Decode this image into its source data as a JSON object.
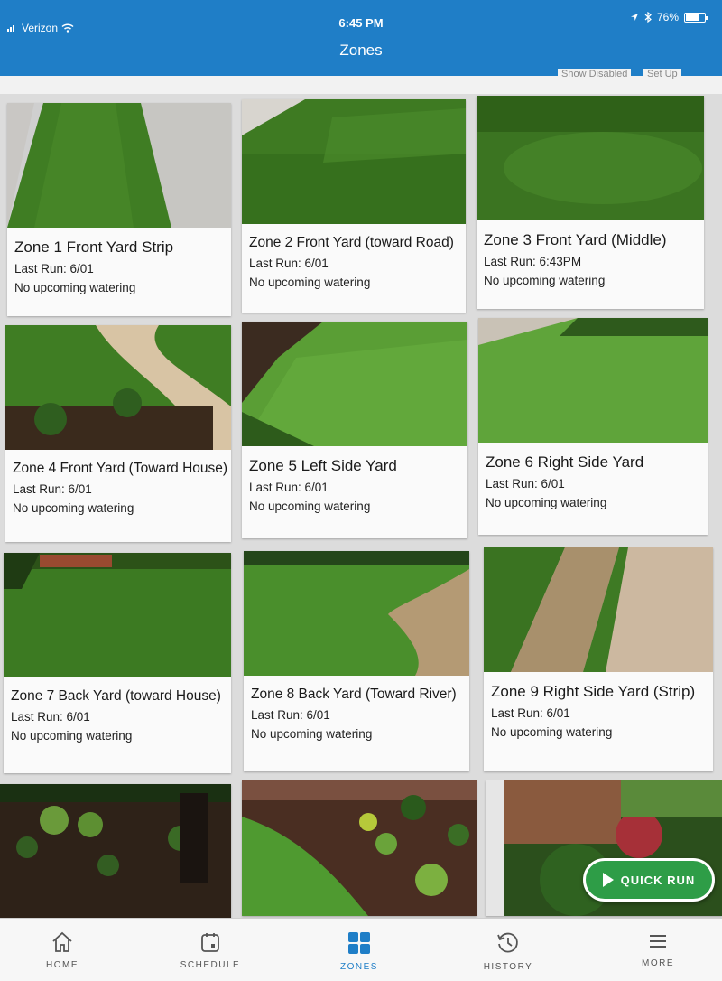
{
  "status_bar": {
    "carrier": "Verizon",
    "time": "6:45 PM",
    "battery": "76%",
    "battery_level": 0.76
  },
  "nav": {
    "title": "Zones"
  },
  "actions": {
    "show_disabled": "Show Disabled",
    "set_up": "Set Up"
  },
  "zones": [
    {
      "name": "Zone 1 Front Yard Strip",
      "last_run": "Last Run: 6/01",
      "upcoming": "No upcoming watering"
    },
    {
      "name": "Zone 2 Front Yard (toward Road)",
      "last_run": "Last Run: 6/01",
      "upcoming": "No upcoming watering"
    },
    {
      "name": "Zone 3 Front Yard (Middle)",
      "last_run": "Last Run: 6:43PM",
      "upcoming": "No upcoming watering"
    },
    {
      "name": "Zone 4 Front Yard (Toward House)",
      "last_run": "Last Run: 6/01",
      "upcoming": "No upcoming watering"
    },
    {
      "name": "Zone 5 Left Side Yard",
      "last_run": "Last Run: 6/01",
      "upcoming": "No upcoming watering"
    },
    {
      "name": "Zone 6 Right Side Yard",
      "last_run": "Last Run: 6/01",
      "upcoming": "No upcoming watering"
    },
    {
      "name": "Zone 7 Back Yard (toward House)",
      "last_run": "Last Run: 6/01",
      "upcoming": "No upcoming watering"
    },
    {
      "name": "Zone 8 Back Yard (Toward River)",
      "last_run": "Last Run: 6/01",
      "upcoming": "No upcoming watering"
    },
    {
      "name": "Zone 9 Right Side Yard (Strip)",
      "last_run": "Last Run: 6/01",
      "upcoming": "No upcoming watering"
    }
  ],
  "quick_run": {
    "label": "QUICK RUN"
  },
  "tabs": [
    {
      "label": "HOME",
      "icon": "home-icon"
    },
    {
      "label": "SCHEDULE",
      "icon": "calendar-icon"
    },
    {
      "label": "ZONES",
      "icon": "grid-icon"
    },
    {
      "label": "HISTORY",
      "icon": "history-icon"
    },
    {
      "label": "MORE",
      "icon": "menu-icon"
    }
  ],
  "colors": {
    "header": "#1f7ec7",
    "active_tab": "#1f7ec7",
    "quick_run": "#2e9d47",
    "grass": "#3f7d23"
  }
}
